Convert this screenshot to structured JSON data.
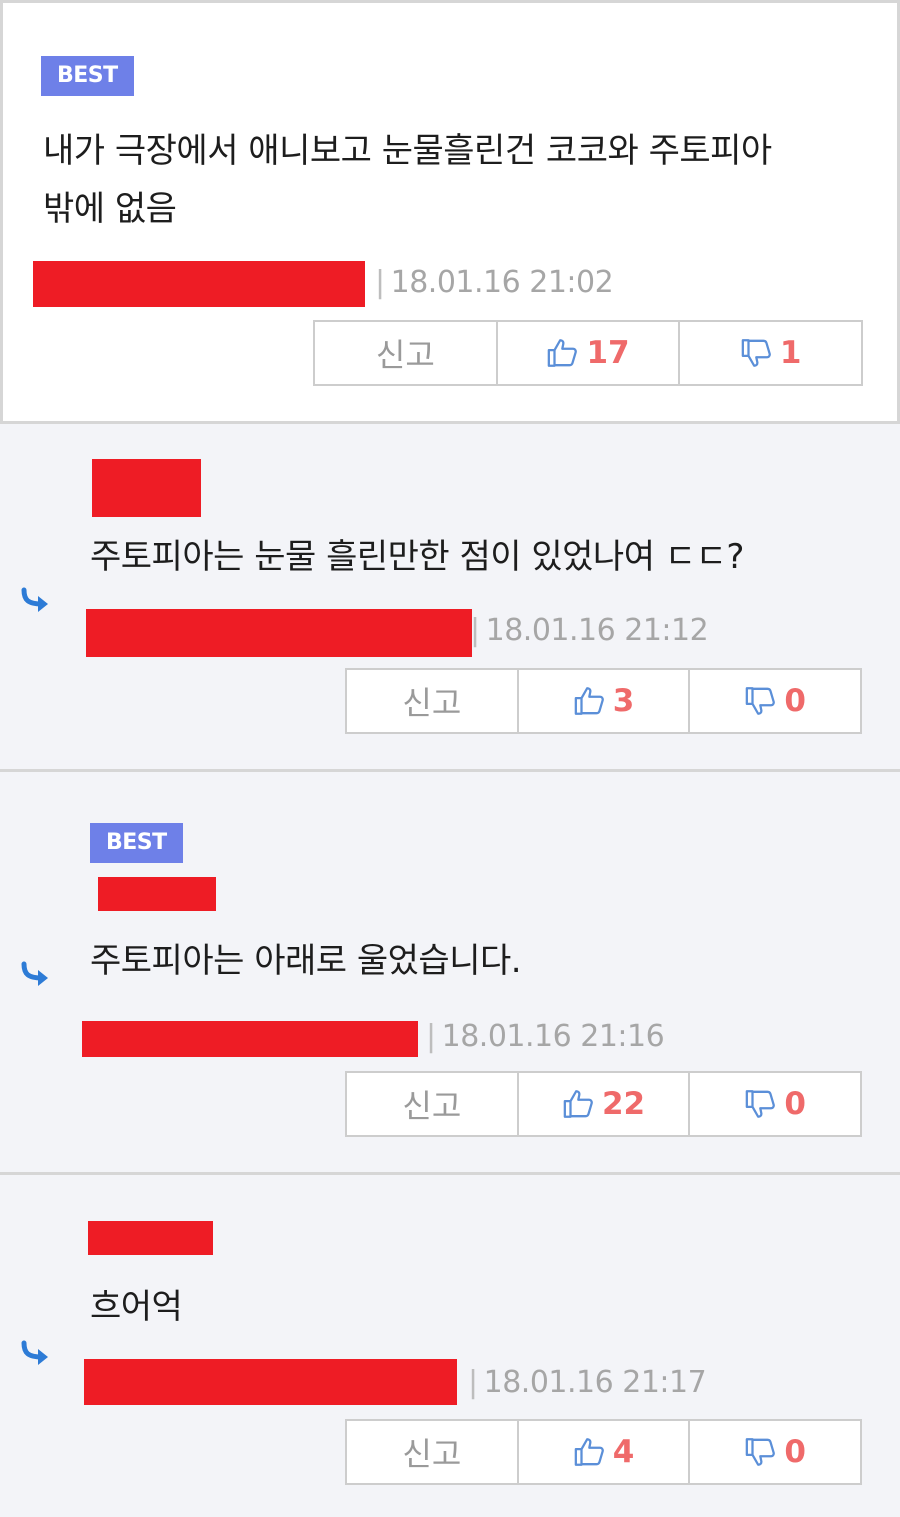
{
  "comments": [
    {
      "best_label": "BEST",
      "text_lines": [
        "내가 극장에서 애니보고 눈물흘린건 코코와 주토피아",
        "밖에 없음"
      ],
      "timestamp": "18.01.16 21:02",
      "report_label": "신고",
      "likes": "17",
      "dislikes": "1"
    },
    {
      "text": "주토피아는 눈물 흘린만한 점이 있었나여 ㄷㄷ?",
      "timestamp": "18.01.16 21:12",
      "report_label": "신고",
      "likes": "3",
      "dislikes": "0"
    },
    {
      "best_label": "BEST",
      "text": "주토피아는 아래로 울었습니다.",
      "timestamp": "18.01.16 21:16",
      "report_label": "신고",
      "likes": "22",
      "dislikes": "0"
    },
    {
      "text": "흐어억",
      "timestamp": "18.01.16 21:17",
      "report_label": "신고",
      "likes": "4",
      "dislikes": "0"
    }
  ],
  "separator": "|",
  "colors": {
    "best_badge": "#6e80e8",
    "redaction": "#ee1c25",
    "count": "#ef6a6a",
    "reply_arrow": "#2d7bd6",
    "thumb": "#5b8fd8"
  }
}
